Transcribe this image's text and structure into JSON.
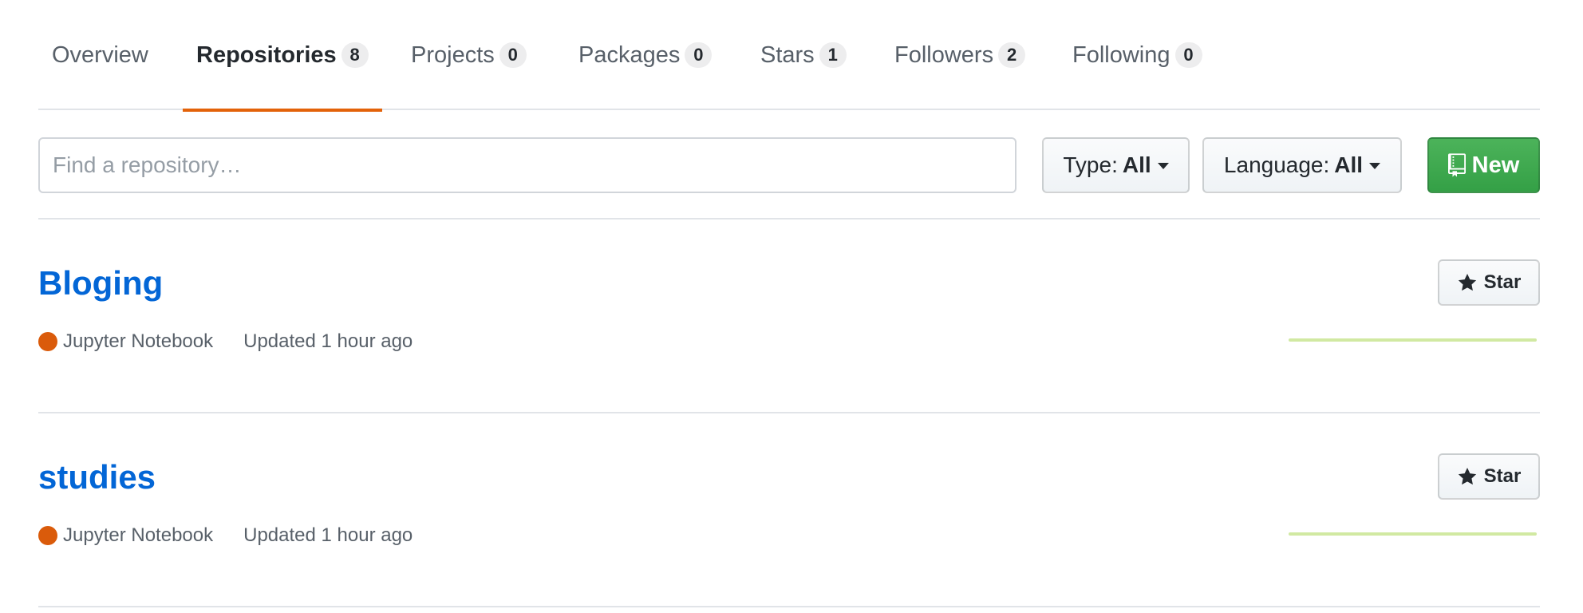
{
  "tabs": [
    {
      "label": "Overview",
      "count": null,
      "selected": false
    },
    {
      "label": "Repositories",
      "count": "8",
      "selected": true
    },
    {
      "label": "Projects",
      "count": "0",
      "selected": false
    },
    {
      "label": "Packages",
      "count": "0",
      "selected": false
    },
    {
      "label": "Stars",
      "count": "1",
      "selected": false
    },
    {
      "label": "Followers",
      "count": "2",
      "selected": false
    },
    {
      "label": "Following",
      "count": "0",
      "selected": false
    }
  ],
  "filters": {
    "search_placeholder": "Find a repository…",
    "search_value": "",
    "type_label": "Type:",
    "type_value": "All",
    "language_label": "Language:",
    "language_value": "All",
    "new_label": "New",
    "new_icon": "repo-icon"
  },
  "repos": [
    {
      "name": "Bloging",
      "language": "Jupyter Notebook",
      "language_color": "#DA5B0B",
      "updated": "Updated 1 hour ago",
      "star_label": "Star",
      "star_icon": "star-icon"
    },
    {
      "name": "studies",
      "language": "Jupyter Notebook",
      "language_color": "#DA5B0B",
      "updated": "Updated 1 hour ago",
      "star_label": "Star",
      "star_icon": "star-icon"
    }
  ],
  "colors": {
    "accent_tab_underline": "#e36209",
    "link": "#0366d6",
    "new_button": "#34a046",
    "sparkline": "#c6e48b"
  }
}
